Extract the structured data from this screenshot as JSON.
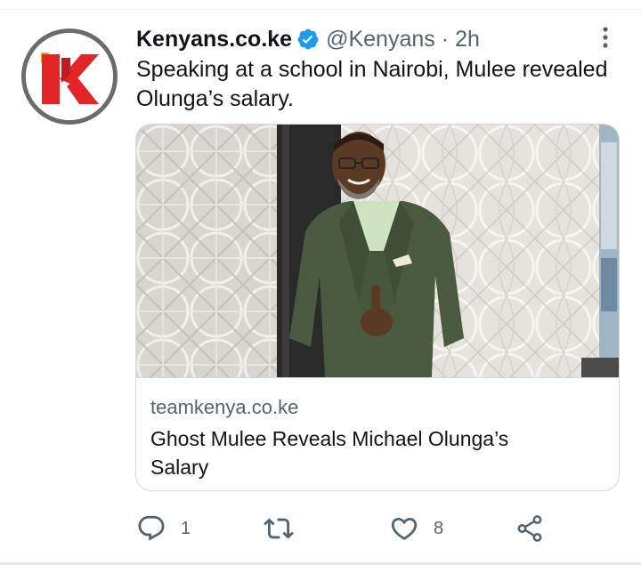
{
  "tweet": {
    "display_name": "Kenyans.co.ke",
    "handle": "@Kenyans",
    "separator": "·",
    "time": "2h",
    "verified": true,
    "text": "Speaking at a school in Nairobi, Mulee revealed Olunga’s salary.",
    "avatar": {
      "logo_letter": "K",
      "brand_color": "#e42528",
      "ring_color": "#6b6b6b"
    }
  },
  "card": {
    "domain": "teamkenya.co.ke",
    "title": "Ghost Mulee Reveals Michael Olunga’s Salary"
  },
  "actions": {
    "reply": {
      "icon": "reply-icon",
      "count": "1"
    },
    "retweet": {
      "icon": "retweet-icon",
      "count": ""
    },
    "like": {
      "icon": "heart-icon",
      "count": "8"
    },
    "share": {
      "icon": "share-icon"
    }
  },
  "colors": {
    "verified_blue": "#1d9bf0",
    "secondary_text": "#536471",
    "primary_text": "#0f1419",
    "border": "#cfd9de"
  }
}
